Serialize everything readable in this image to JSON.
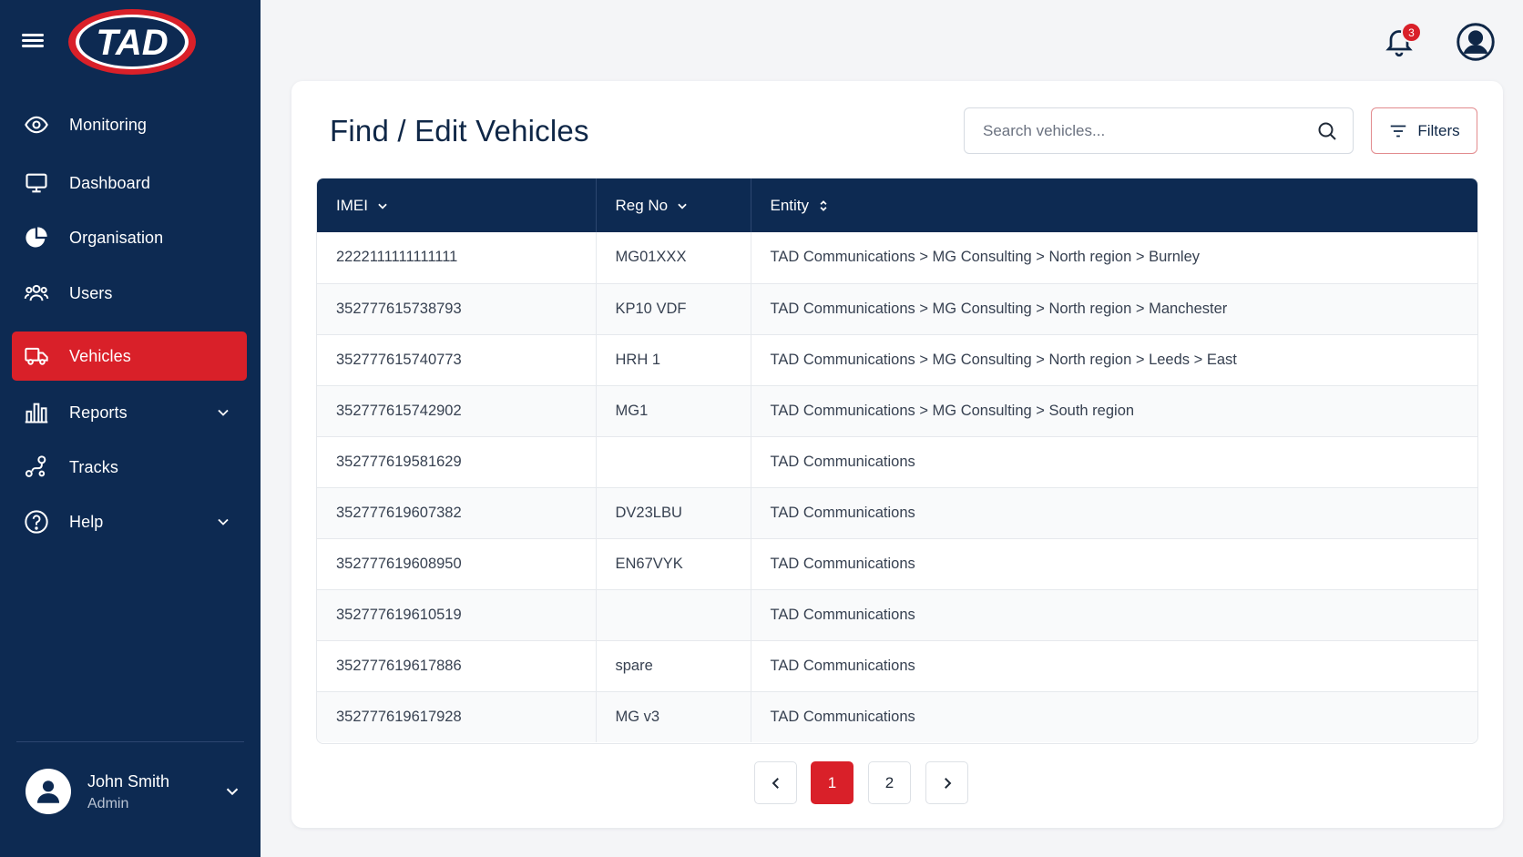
{
  "brand": {
    "logo_text": "TAD"
  },
  "sidebar": {
    "items": [
      {
        "label": "Monitoring",
        "icon": "eye-icon",
        "active": false,
        "expandable": false
      },
      {
        "label": "Dashboard",
        "icon": "monitor-icon",
        "active": false,
        "expandable": false
      },
      {
        "label": "Organisation",
        "icon": "pie-chart-icon",
        "active": false,
        "expandable": false
      },
      {
        "label": "Users",
        "icon": "users-icon",
        "active": false,
        "expandable": false
      },
      {
        "label": "Vehicles",
        "icon": "truck-icon",
        "active": true,
        "expandable": false
      },
      {
        "label": "Reports",
        "icon": "bar-chart-icon",
        "active": false,
        "expandable": true
      },
      {
        "label": "Tracks",
        "icon": "route-icon",
        "active": false,
        "expandable": false
      },
      {
        "label": "Help",
        "icon": "help-circle-icon",
        "active": false,
        "expandable": true
      }
    ],
    "user": {
      "name": "John Smith",
      "role": "Admin"
    }
  },
  "topbar": {
    "notification_count": "3"
  },
  "main": {
    "title": "Find / Edit Vehicles",
    "search": {
      "placeholder": "Search vehicles...",
      "value": ""
    },
    "filters_label": "Filters"
  },
  "table": {
    "columns": [
      {
        "label": "IMEI",
        "sort": "desc"
      },
      {
        "label": "Reg No",
        "sort": "desc"
      },
      {
        "label": "Entity",
        "sort": "both"
      }
    ],
    "rows": [
      [
        "2222111111111111",
        "MG01XXX",
        "TAD Communications > MG Consulting > North region > Burnley"
      ],
      [
        "352777615738793",
        "KP10 VDF",
        "TAD Communications > MG Consulting > North region > Manchester"
      ],
      [
        "352777615740773",
        "HRH 1",
        "TAD Communications > MG Consulting > North region > Leeds > East"
      ],
      [
        "352777615742902",
        "MG1",
        "TAD Communications > MG Consulting > South region"
      ],
      [
        "352777619581629",
        "",
        "TAD Communications"
      ],
      [
        "352777619607382",
        "DV23LBU",
        "TAD Communications"
      ],
      [
        "352777619608950",
        "EN67VYK",
        "TAD Communications"
      ],
      [
        "352777619610519",
        "",
        "TAD Communications"
      ],
      [
        "352777619617886",
        "spare",
        "TAD Communications"
      ],
      [
        "352777619617928",
        "MG v3",
        "TAD Communications"
      ]
    ]
  },
  "pagination": {
    "pages": [
      "1",
      "2"
    ],
    "current": "1"
  },
  "colors": {
    "sidebar_bg": "#0d2a52",
    "accent_red": "#d92029",
    "page_bg": "#f4f5f7",
    "table_header_bg": "#0d2a52"
  }
}
